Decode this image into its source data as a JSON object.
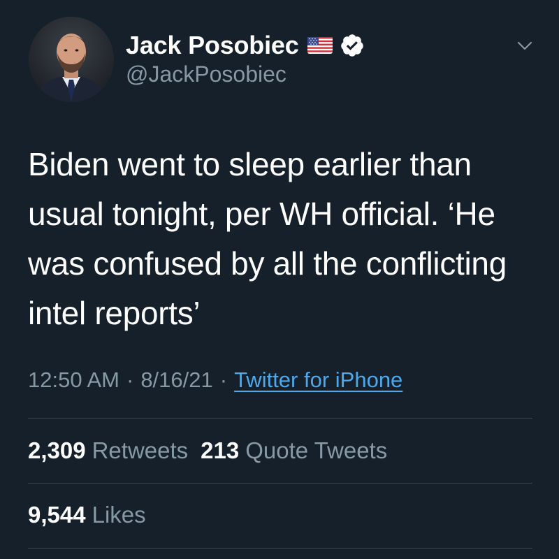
{
  "author": {
    "display_name": "Jack Posobiec",
    "handle": "@JackPosobiec",
    "flag_icon": "us-flag-emoji",
    "verified_icon": "verified-badge-icon"
  },
  "tweet": {
    "text": "Biden went to sleep earlier than usual tonight, per WH official. ‘He was confused by all the conflicting intel reports’",
    "time": "12:50 AM",
    "separator": "·",
    "date": "8/16/21",
    "source": "Twitter for iPhone"
  },
  "stats": {
    "retweets_count": "2,309",
    "retweets_label": "Retweets",
    "quotes_count": "213",
    "quotes_label": "Quote Tweets",
    "likes_count": "9,544",
    "likes_label": "Likes"
  },
  "colors": {
    "background": "#15202b",
    "primary_text": "#ffffff",
    "secondary_text": "#8899a6",
    "link": "#4fa8ea",
    "divider": "#38444d"
  },
  "icons": {
    "menu": "chevron-down-icon"
  }
}
